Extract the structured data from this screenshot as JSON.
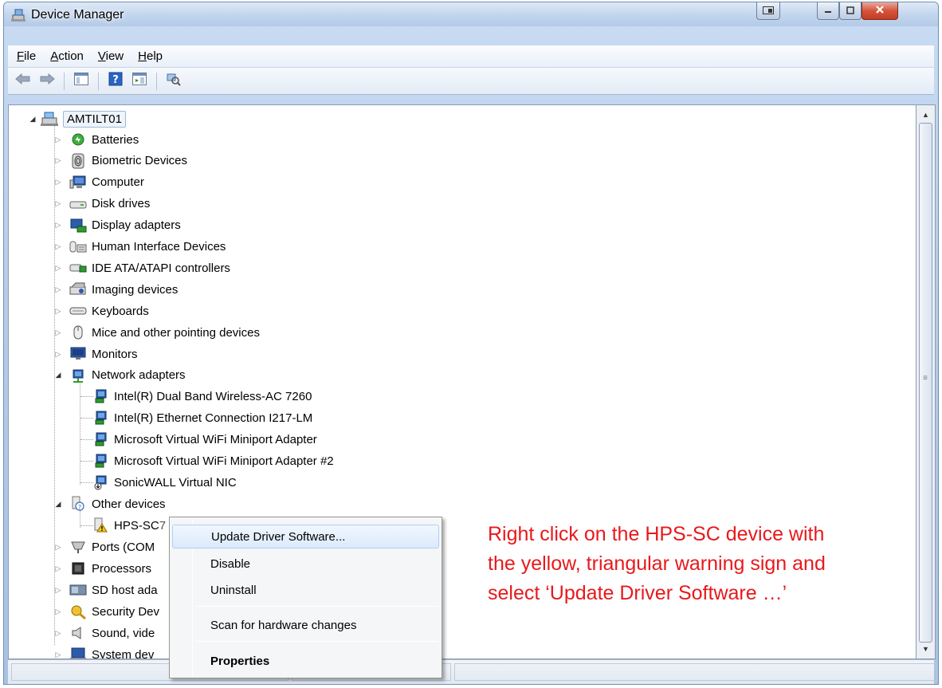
{
  "window": {
    "title": "Device Manager"
  },
  "menubar": {
    "items": [
      {
        "label": "File",
        "underline": "F",
        "rest": "ile"
      },
      {
        "label": "Action",
        "underline": "A",
        "rest": "ction"
      },
      {
        "label": "View",
        "underline": "V",
        "rest": "iew"
      },
      {
        "label": "Help",
        "underline": "H",
        "rest": "elp"
      }
    ]
  },
  "toolbar": {
    "tools": [
      "back-arrow-icon",
      "forward-arrow-icon",
      "properties-icon",
      "help-icon",
      "show-hidden-icon",
      "scan-hardware-icon"
    ]
  },
  "tree": {
    "root": "AMTILT01",
    "categories": [
      {
        "label": "Batteries",
        "icon": "battery-icon"
      },
      {
        "label": "Biometric Devices",
        "icon": "fingerprint-icon"
      },
      {
        "label": "Computer",
        "icon": "computer-icon"
      },
      {
        "label": "Disk drives",
        "icon": "disk-drive-icon"
      },
      {
        "label": "Display adapters",
        "icon": "display-adapter-icon"
      },
      {
        "label": "Human Interface Devices",
        "icon": "hid-icon"
      },
      {
        "label": "IDE ATA/ATAPI controllers",
        "icon": "ide-controller-icon"
      },
      {
        "label": "Imaging devices",
        "icon": "imaging-device-icon"
      },
      {
        "label": "Keyboards",
        "icon": "keyboard-icon"
      },
      {
        "label": "Mice and other pointing devices",
        "icon": "mouse-icon"
      },
      {
        "label": "Monitors",
        "icon": "monitor-icon"
      },
      {
        "label": "Network adapters",
        "icon": "network-adapter-icon"
      }
    ],
    "network_adapters": [
      "Intel(R) Dual Band Wireless-AC 7260",
      "Intel(R) Ethernet Connection I217-LM",
      "Microsoft Virtual WiFi Miniport Adapter",
      "Microsoft Virtual WiFi Miniport Adapter #2",
      "SonicWALL Virtual NIC"
    ],
    "other_devices": "Other devices",
    "other_child": "HPS-SC",
    "other_child_suffix": "7",
    "lower_categories": [
      {
        "label": "Ports (COM",
        "icon": "port-icon"
      },
      {
        "label": "Processors",
        "icon": "processor-icon"
      },
      {
        "label": "SD host ada",
        "icon": "sd-host-icon"
      },
      {
        "label": "Security Dev",
        "icon": "security-device-icon"
      },
      {
        "label": "Sound, vide",
        "icon": "sound-icon"
      },
      {
        "label": "System dev",
        "icon": "system-device-icon"
      }
    ]
  },
  "context_menu": {
    "update": "Update Driver Software...",
    "disable": "Disable",
    "uninstall": "Uninstall",
    "scan": "Scan for hardware changes",
    "properties": "Properties"
  },
  "annotation": {
    "line1": "Right click on the  HPS-SC device with",
    "line2": "the yellow, triangular warning sign and",
    "line3": "select ‘Update Driver Software …’",
    "color": "#e8191c"
  }
}
